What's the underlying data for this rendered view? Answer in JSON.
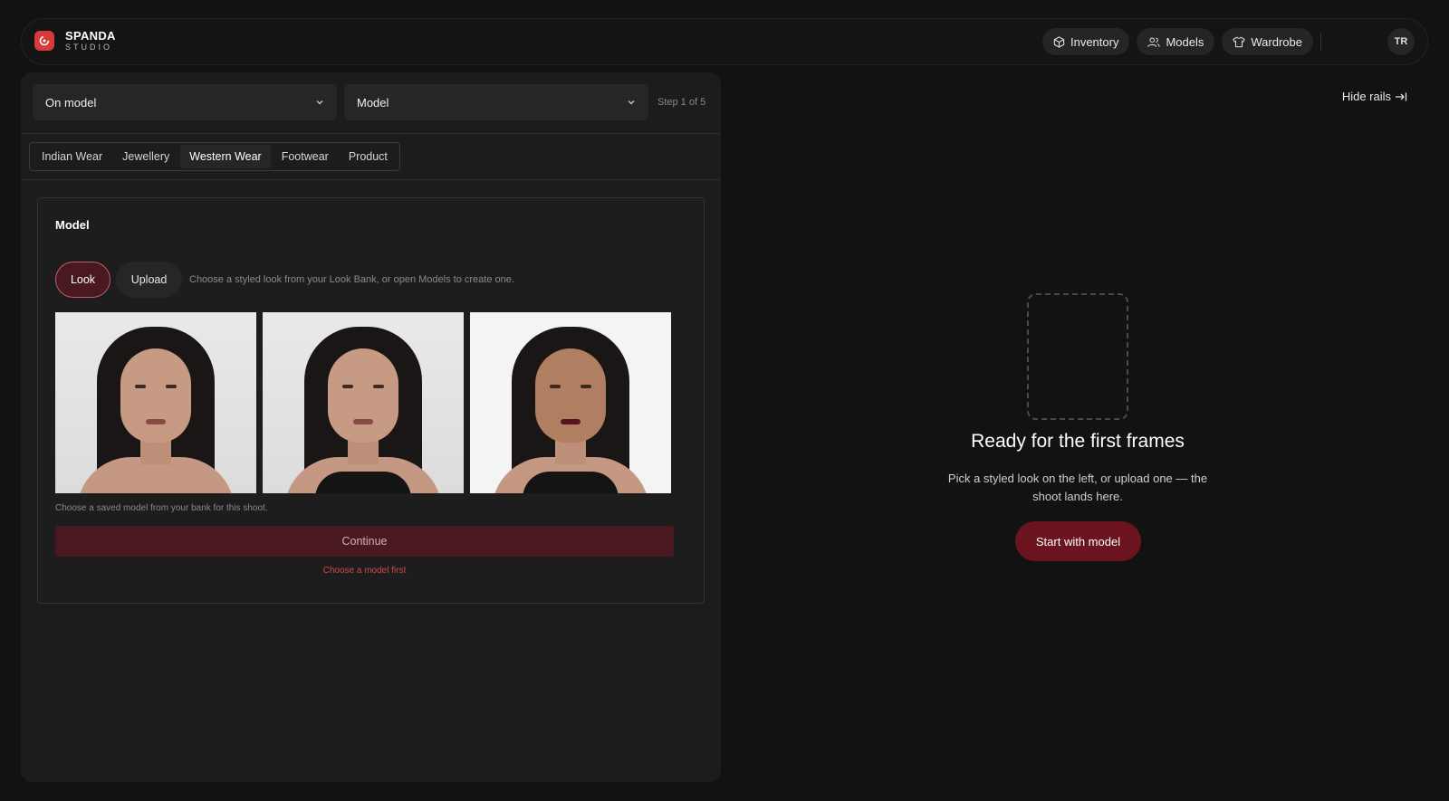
{
  "brand": {
    "name": "SPANDA",
    "sub": "STUDIO"
  },
  "nav": [
    {
      "label": "Inventory",
      "icon": "box-icon"
    },
    {
      "label": "Models",
      "icon": "users-icon"
    },
    {
      "label": "Wardrobe",
      "icon": "shirt-icon"
    }
  ],
  "avatar": "TR",
  "selects": {
    "first": "On model",
    "second": "Model",
    "step": "Step 1 of 5"
  },
  "tabs": [
    "Indian Wear",
    "Jewellery",
    "Western Wear",
    "Footwear",
    "Product"
  ],
  "active_tab": "Western Wear",
  "card": {
    "title": "Model",
    "mode_look": "Look",
    "mode_upload": "Upload",
    "mode_hint": "Choose a styled look from your Look Bank, or open Models to create one.",
    "note": "Choose a saved model from your bank for this shoot.",
    "continue": "Continue",
    "warning": "Choose a model first"
  },
  "right": {
    "hide_rails": "Hide rails",
    "title": "Ready for the first frames",
    "desc": "Pick a styled look on the left, or upload one — the shoot lands here.",
    "start": "Start with model"
  },
  "colors": {
    "accent": "#6b1420",
    "warning": "#d04a4a",
    "logo": "#d63a3a"
  }
}
